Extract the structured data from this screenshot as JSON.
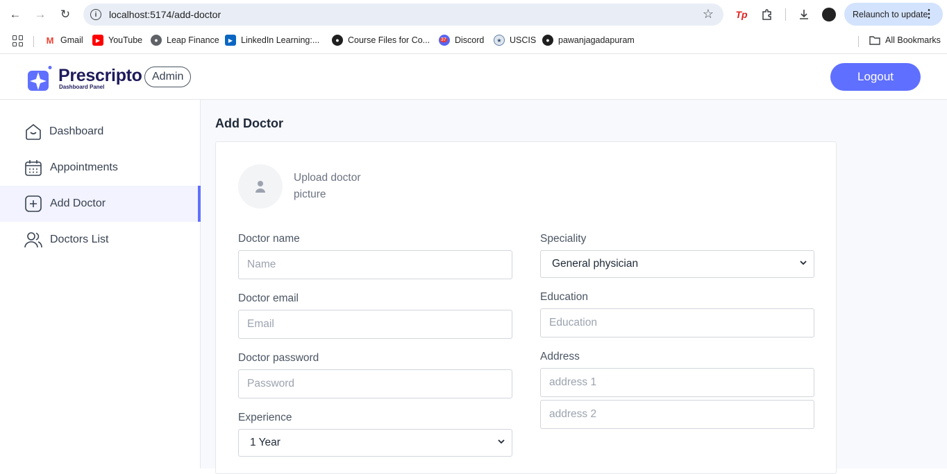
{
  "browser": {
    "url": "localhost:5174/add-doctor",
    "relaunch_label": "Relaunch to update",
    "bookmarks": [
      {
        "label": "Gmail",
        "icon": "gmail-icon"
      },
      {
        "label": "YouTube",
        "icon": "youtube-icon"
      },
      {
        "label": "Leap Finance",
        "icon": "globe-icon"
      },
      {
        "label": "LinkedIn Learning:...",
        "icon": "linkedin-learning-icon"
      },
      {
        "label": "Course Files for Co...",
        "icon": "github-icon"
      },
      {
        "label": "Discord",
        "icon": "discord-icon",
        "badge": "37"
      },
      {
        "label": "USCIS",
        "icon": "uscis-icon"
      },
      {
        "label": "pawanjagadapuram",
        "icon": "github-icon"
      }
    ],
    "all_bookmarks_label": "All Bookmarks"
  },
  "header": {
    "brand": "Prescripto",
    "brand_sub": "Dashboard Panel",
    "role": "Admin",
    "logout_label": "Logout",
    "accent": "#5f6fff"
  },
  "sidebar": {
    "items": [
      {
        "label": "Dashboard",
        "icon": "home-icon",
        "active": false
      },
      {
        "label": "Appointments",
        "icon": "calendar-icon",
        "active": false
      },
      {
        "label": "Add Doctor",
        "icon": "add-square-icon",
        "active": true
      },
      {
        "label": "Doctors List",
        "icon": "people-icon",
        "active": false
      }
    ]
  },
  "main": {
    "title": "Add Doctor",
    "upload_text": "Upload doctor picture",
    "fields": {
      "name": {
        "label": "Doctor name",
        "placeholder": "Name"
      },
      "email": {
        "label": "Doctor email",
        "placeholder": "Email"
      },
      "password": {
        "label": "Doctor password",
        "placeholder": "Password"
      },
      "experience": {
        "label": "Experience",
        "value": "1 Year"
      },
      "speciality": {
        "label": "Speciality",
        "value": "General physician"
      },
      "education": {
        "label": "Education",
        "placeholder": "Education"
      },
      "address": {
        "label": "Address",
        "placeholder1": "address 1",
        "placeholder2": "address 2"
      }
    }
  }
}
